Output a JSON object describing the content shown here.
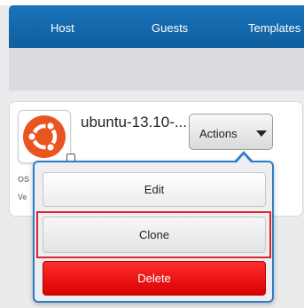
{
  "nav": {
    "tabs": [
      {
        "label": "Host"
      },
      {
        "label": "Guests"
      },
      {
        "label": "Templates"
      }
    ]
  },
  "template": {
    "name": "ubuntu-13.10-...",
    "icon": "ubuntu-logo-icon",
    "partial_labels": [
      "OS",
      "Ve"
    ]
  },
  "actions": {
    "label": "Actions",
    "menu": {
      "edit": "Edit",
      "clone": "Clone",
      "delete": "Delete"
    }
  },
  "colors": {
    "nav": "#1268ad",
    "ubuntu": "#e95420",
    "delete": "#e60000",
    "highlight": "#e2232a",
    "popover_border": "#2f7cc6"
  }
}
